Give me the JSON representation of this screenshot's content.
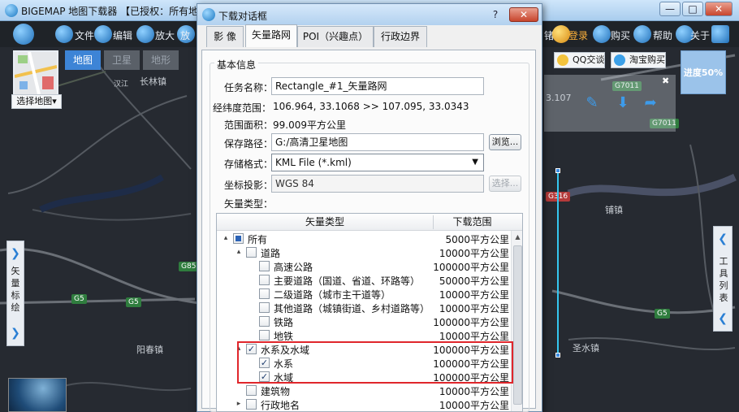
{
  "main_window": {
    "title": "BIGEMAP 地图下载器 【已授权：所有地图】",
    "win_minimize": "—",
    "win_restore": "□",
    "win_close": "✕"
  },
  "toolbar": {
    "file": "文件",
    "edit": "编辑",
    "zoom_in": "放大",
    "zoom_out": "放",
    "login_partial": "锗",
    "login": "登录",
    "buy": "购买",
    "help": "帮助",
    "about_partial": "关于"
  },
  "map": {
    "select_map": "选择地图▾",
    "tabs": [
      "地图",
      "卫星",
      "地形"
    ],
    "labels": {
      "changlin": "长林镇",
      "yangchun": "阳春镇",
      "puchuan": "铺镇",
      "shengshui": "圣水镇",
      "han": "汉江",
      "coord_partial": "3.107"
    },
    "shields": {
      "g85": "G85",
      "g5_a": "G5",
      "g5_b": "G5",
      "g5_c": "G5",
      "g7011_a": "G7011",
      "g7011_b": "G7011",
      "g316": "G316"
    },
    "side_left": "矢量标绘",
    "side_right": "工具列表",
    "qq_chat": "QQ交谈",
    "taobao": "淘宝购买",
    "progress": "进度50%",
    "close_x": "✖"
  },
  "dialog": {
    "title": "下载对话框",
    "help": "?",
    "close": "✕",
    "tabs": [
      "影 像",
      "矢量路网",
      "POI（兴趣点）",
      "行政边界"
    ],
    "active_tab": "矢量路网",
    "group_title": "基本信息",
    "fields": {
      "task_name_label": "任务名称：",
      "task_name_value": "Rectangle_#1_矢量路网",
      "extent_label": "经纬度范围：",
      "extent_value": "106.964, 33.1068   >>   107.095, 33.0343",
      "area_label": "范围面积：",
      "area_value": "99.009平方公里",
      "save_path_label": "保存路径：",
      "save_path_value": "G:/高清卫星地图",
      "browse": "浏览...",
      "format_label": "存储格式：",
      "format_value": "KML File (*.kml)",
      "projection_label": "坐标投影：",
      "projection_value": "WGS 84",
      "choose": "选择...",
      "vector_type_label": "矢量类型："
    },
    "tree": {
      "col_type": "矢量类型",
      "col_range": "下载范围",
      "rows": [
        {
          "name": "所有",
          "range": "5000平方公里",
          "check": "partial",
          "twist": "▴"
        },
        {
          "name": "道路",
          "range": "10000平方公里",
          "check": "off",
          "twist": "▴"
        },
        {
          "name": "高速公路",
          "range": "100000平方公里",
          "check": "off",
          "twist": ""
        },
        {
          "name": "主要道路（国道、省道、环路等）",
          "range": "50000平方公里",
          "check": "off",
          "twist": ""
        },
        {
          "name": "二级道路（城市主干道等）",
          "range": "10000平方公里",
          "check": "off",
          "twist": ""
        },
        {
          "name": "其他道路（城镇街道、乡村道路等）",
          "range": "10000平方公里",
          "check": "off",
          "twist": ""
        },
        {
          "name": "铁路",
          "range": "100000平方公里",
          "check": "off",
          "twist": ""
        },
        {
          "name": "地铁",
          "range": "10000平方公里",
          "check": "off",
          "twist": ""
        },
        {
          "name": "水系及水域",
          "range": "100000平方公里",
          "check": "on",
          "twist": "▴"
        },
        {
          "name": "水系",
          "range": "100000平方公里",
          "check": "on",
          "twist": ""
        },
        {
          "name": "水域",
          "range": "100000平方公里",
          "check": "on",
          "twist": ""
        },
        {
          "name": "建筑物",
          "range": "10000平方公里",
          "check": "off",
          "twist": ""
        },
        {
          "name": "行政地名",
          "range": "10000平方公里",
          "check": "off",
          "twist": "▸"
        }
      ]
    }
  }
}
